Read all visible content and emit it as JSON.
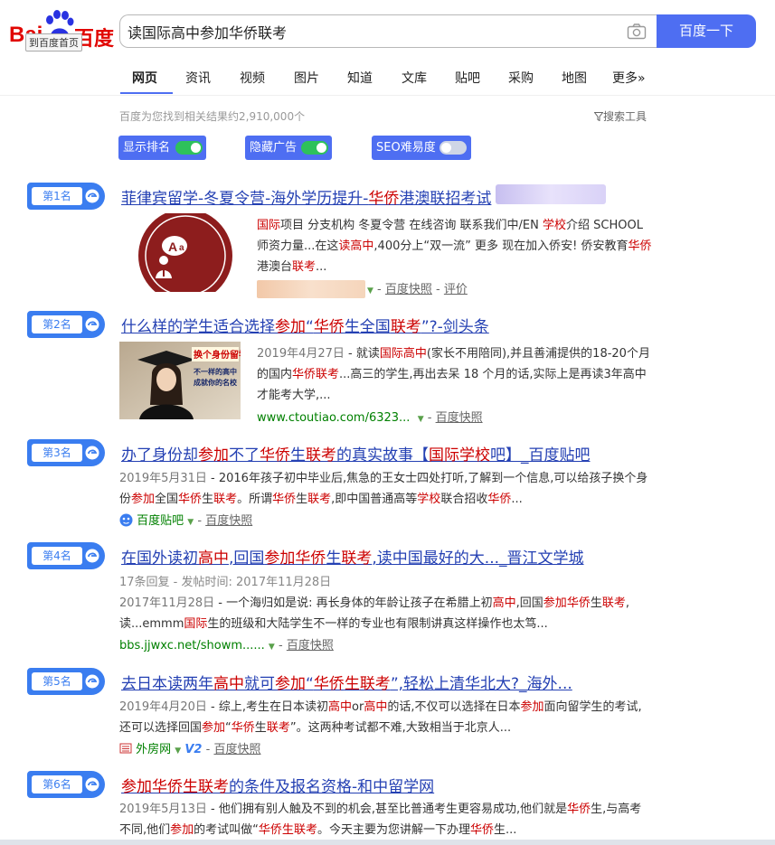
{
  "header": {
    "logo_bai": "Bai",
    "logo_du": "百度",
    "home_btn": "到百度首页",
    "search_value": "读国际高中参加华侨联考",
    "search_btn": "百度一下"
  },
  "tabs": [
    "网页",
    "资讯",
    "视频",
    "图片",
    "知道",
    "文库",
    "贴吧",
    "采购",
    "地图",
    "更多»"
  ],
  "result_count": "百度为您找到相关结果约2,910,000个",
  "search_tools": "搜索工具",
  "toggles": [
    {
      "label": "显示排名",
      "state": "on"
    },
    {
      "label": "隐藏广告",
      "state": "on"
    },
    {
      "label": "SEO难易度",
      "state": "off"
    }
  ],
  "results": [
    {
      "rank": "第1名",
      "title_parts": [
        "菲律宾留学-冬夏令营-海外学历提升-",
        "华侨",
        "港澳联招考试"
      ],
      "abstract_parts": [
        "国际",
        "项目 分支机构 冬夏令营 在线咨询 联系我们中/EN ",
        "学校",
        "介绍 SCHOOL 师资力量...在这",
        "读高中",
        ",400分上“双一流” 更多 现在加入侨安! 侨安教育",
        "华侨",
        "港澳台",
        "联考",
        "..."
      ],
      "links": [
        "百度快照",
        "评价"
      ]
    },
    {
      "rank": "第2名",
      "title_parts": [
        "什么样的学生适合选择",
        "参加",
        "“",
        "华侨",
        "生全国",
        "联考",
        "”?-剑头条"
      ],
      "date": "2019年4月27日",
      "abstract_parts": [
        " - 就读",
        "国际高中",
        "(家长不用陪同),并且善浦提供的18-20个月的国内",
        "华侨联考",
        "...高三的学生,再出去呆 18 个月的话,实际上是再读3年高中才能考大学,..."
      ],
      "url": "www.ctoutiao.com/6323...",
      "links": [
        "百度快照"
      ],
      "thumb_caption": [
        "换个身份留学",
        "不一样的高中",
        "成就你的名校"
      ]
    },
    {
      "rank": "第3名",
      "title_parts": [
        "办了身份却",
        "参加",
        "不了",
        "华侨",
        "生",
        "联考",
        "的真实故事【",
        "国际学校",
        "吧】_百度贴吧"
      ],
      "date": "2019年5月31日",
      "abstract_parts": [
        " - 2016年孩子初中毕业后,焦急的王女士四处打听,了解到一个信息,可以给孩子换个身份",
        "参加",
        "全国",
        "华侨",
        "生",
        "联考",
        "。所谓",
        "华侨",
        "生",
        "联考",
        ",即中国普通高等",
        "学校",
        "联合招收",
        "华侨",
        "..."
      ],
      "source": "百度贴吧",
      "links": [
        "百度快照"
      ]
    },
    {
      "rank": "第4名",
      "title_parts": [
        "在国外读初",
        "高中",
        ",回国",
        "参加",
        "华侨",
        "生",
        "联考",
        ",读中国最好的大..._晋江文学城"
      ],
      "meta": "17条回复 - 发帖时间: 2017年11月28日",
      "date": "2017年11月28日",
      "abstract_parts": [
        " - 一个海归如是说: 再长身体的年龄让孩子在希腊上初",
        "高中",
        ",回国",
        "参加",
        "华侨",
        "生",
        "联考",
        ",读...emmm",
        "国际",
        "生的班级和大陆学生不一样的专业也有限制讲真这样操作也太笃..."
      ],
      "url": "bbs.jjwxc.net/showm......",
      "links": [
        "百度快照"
      ]
    },
    {
      "rank": "第5名",
      "title_parts": [
        "去日本读两年",
        "高中",
        "就可",
        "参加",
        "“",
        "华侨",
        "生",
        "联考",
        "”,轻松上清华北大?_海外..."
      ],
      "date": "2019年4月20日",
      "abstract_parts": [
        " - 综上,考生在日本读初",
        "高中",
        "or",
        "高中",
        "的话,不仅可以选择在日本",
        "参加",
        "面向留学生的考试,还可以选择回国",
        "参加",
        "“",
        "华侨",
        "生",
        "联考",
        "”。这两种考试都不难,大致相当于北京人..."
      ],
      "source": "外房网",
      "badge": "V2",
      "links": [
        "百度快照"
      ]
    },
    {
      "rank": "第6名",
      "title_parts": [
        "参加",
        "华侨",
        "生",
        "联考",
        "的条件及报名资格-和中留学网"
      ],
      "date": "2019年5月13日",
      "abstract_parts": [
        " - 他们拥有别人触及不到的机会,甚至比普通考生更容易成功,他们就是",
        "华侨",
        "生,与高考不同,他们",
        "参加",
        "的考试叫做“",
        "华侨",
        "生",
        "联考",
        "。今天主要为您讲解一下办理",
        "华侨",
        "生..."
      ]
    }
  ]
}
